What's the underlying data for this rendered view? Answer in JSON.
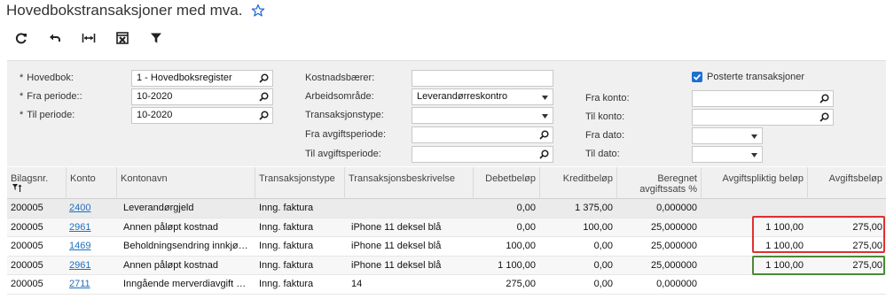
{
  "page": {
    "title": "Hovedbokstransaksjoner med mva."
  },
  "toolbar": {
    "buttons": [
      {
        "name": "refresh-button",
        "icon": "refresh-icon"
      },
      {
        "name": "undo-button",
        "icon": "undo-icon"
      },
      {
        "name": "fit-columns-button",
        "icon": "fit-width-icon"
      },
      {
        "name": "export-excel-button",
        "icon": "excel-icon"
      },
      {
        "name": "filter-button",
        "icon": "filter-icon"
      }
    ]
  },
  "filters": {
    "required_marker": "*",
    "hovedbok": {
      "label": "Hovedbok:",
      "value": "1 - Hovedboksregister"
    },
    "fra_periode": {
      "label": "Fra periode::",
      "value": "10-2020"
    },
    "til_periode": {
      "label": "Til periode:",
      "value": "10-2020"
    },
    "kostnadsbaerer": {
      "label": "Kostnadsbærer:",
      "value": ""
    },
    "arbeidsomrade": {
      "label": "Arbeidsområde:",
      "value": "Leverandørreskontro"
    },
    "transaksjonstype": {
      "label": "Transaksjonstype:",
      "value": ""
    },
    "fra_avgiftsperiode": {
      "label": "Fra avgiftsperiode:",
      "value": ""
    },
    "til_avgiftsperiode": {
      "label": "Til avgiftsperiode:",
      "value": ""
    },
    "posterte": {
      "label": "Posterte transaksjoner",
      "checked": true
    },
    "fra_konto": {
      "label": "Fra konto:",
      "value": ""
    },
    "til_konto": {
      "label": "Til konto:",
      "value": ""
    },
    "fra_dato": {
      "label": "Fra dato:",
      "value": ""
    },
    "til_dato": {
      "label": "Til dato:",
      "value": ""
    }
  },
  "grid": {
    "columns": [
      "Bilagsnr.",
      "Konto",
      "Kontonavn",
      "Transaksjonstype",
      "Transaksjonsbeskrivelse",
      "Debetbeløp",
      "Kreditbeløp",
      "Beregnet avgiftssats %",
      "Avgiftspliktig beløp",
      "Avgiftsbeløp"
    ],
    "rows": [
      [
        "200005",
        "2400",
        "Leverandørgjeld",
        "Inng. faktura",
        "",
        "0,00",
        "1 375,00",
        "0,000000",
        "",
        ""
      ],
      [
        "200005",
        "2961",
        "Annen påløpt kostnad",
        "Inng. faktura",
        "iPhone 11 deksel blå",
        "0,00",
        "100,00",
        "25,000000",
        "1 100,00",
        "275,00"
      ],
      [
        "200005",
        "1469",
        "Beholdningsendring innkjøpte ...",
        "Inng. faktura",
        "iPhone 11 deksel blå",
        "100,00",
        "0,00",
        "25,000000",
        "1 100,00",
        "275,00"
      ],
      [
        "200005",
        "2961",
        "Annen påløpt kostnad",
        "Inng. faktura",
        "iPhone 11 deksel blå",
        "1 100,00",
        "0,00",
        "25,000000",
        "1 100,00",
        "275,00"
      ],
      [
        "200005",
        "2711",
        "Inngående merverdiavgift høy ...",
        "Inng. faktura",
        "14",
        "275,00",
        "0,00",
        "0,000000",
        "",
        ""
      ]
    ]
  },
  "colors": {
    "link": "#1f6fbf",
    "highlight_red": "#e03030",
    "highlight_green": "#4a8a34",
    "checkbox": "#1e6fd1"
  }
}
